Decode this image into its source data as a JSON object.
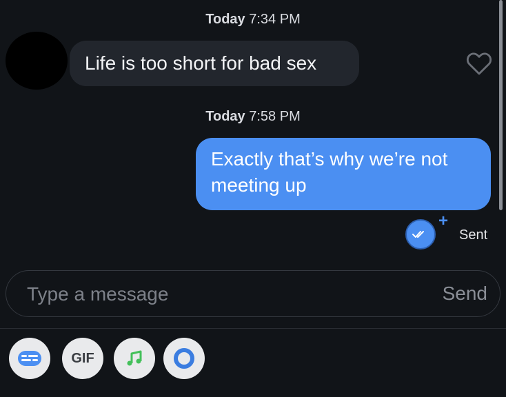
{
  "conversation": {
    "timestamp1": {
      "day": "Today",
      "time": "7:34 PM"
    },
    "incoming_message": "Life is too short for bad sex",
    "timestamp2": {
      "day": "Today",
      "time": "7:58 PM"
    },
    "outgoing_message_line1": "Exactly that’s why we’re not",
    "outgoing_message_line2": "meeting up",
    "status": "Sent"
  },
  "composer": {
    "placeholder": "Type a message",
    "send_label": "Send"
  },
  "toolbar": {
    "gif_label": "GIF"
  },
  "colors": {
    "background": "#111418",
    "incoming_bubble": "#22262d",
    "outgoing_bubble": "#4b8ff2",
    "accent": "#4b8ff2",
    "music_icon": "#43c05a",
    "circle_icon": "#3b7de0"
  },
  "icons": [
    "heart-icon",
    "read-receipt-icon",
    "plus-icon",
    "sticker-icon",
    "gif-icon",
    "music-icon",
    "circle-icon"
  ]
}
